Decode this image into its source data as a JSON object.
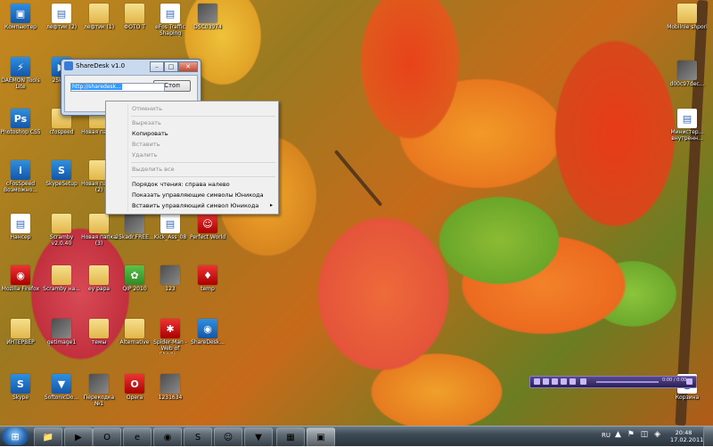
{
  "desktop_icons": [
    {
      "label": "Компьютер",
      "kind": "blue",
      "glyph": "▣"
    },
    {
      "label": "лефтик (2)",
      "kind": "doc",
      "glyph": "▤"
    },
    {
      "label": "лефтик (1)",
      "kind": "folder",
      "glyph": ""
    },
    {
      "label": "ФОТО Т",
      "kind": "folder",
      "glyph": ""
    },
    {
      "label": "eFos Traffic Shaping",
      "kind": "doc",
      "glyph": "▤"
    },
    {
      "label": "DSC03974",
      "kind": "photo",
      "glyph": ""
    },
    {
      "label": "DAEMON Tools Lite",
      "kind": "blue",
      "glyph": "⚡"
    },
    {
      "label": "25kadr",
      "kind": "blue",
      "glyph": "▶"
    },
    {
      "label": "Photoshop CS5",
      "kind": "blue",
      "glyph": "Ps"
    },
    {
      "label": "cfospeed",
      "kind": "folder",
      "glyph": ""
    },
    {
      "label": "Новая папка",
      "kind": "folder",
      "glyph": ""
    },
    {
      "label": "cFosSpeed Возможно...",
      "kind": "blue",
      "glyph": "i"
    },
    {
      "label": "SkypeSetup",
      "kind": "blue",
      "glyph": "S"
    },
    {
      "label": "Новая папка (2)",
      "kind": "folder",
      "glyph": ""
    },
    {
      "label": "Нансер",
      "kind": "doc",
      "glyph": "▤"
    },
    {
      "label": "Scramby v2.0.40",
      "kind": "folder",
      "glyph": ""
    },
    {
      "label": "Новая папка (3)",
      "kind": "folder",
      "glyph": ""
    },
    {
      "label": "25kadr.FREE...",
      "kind": "photo",
      "glyph": ""
    },
    {
      "label": "Kick_Ass_08",
      "kind": "doc",
      "glyph": "▤"
    },
    {
      "label": "Perfect World",
      "kind": "red",
      "glyph": "☺"
    },
    {
      "label": "Mozilla Firefox",
      "kind": "red",
      "glyph": "◉"
    },
    {
      "label": "Scramby на...",
      "kind": "folder",
      "glyph": ""
    },
    {
      "label": "ey papa",
      "kind": "folder",
      "glyph": ""
    },
    {
      "label": "QIP 2010",
      "kind": "green",
      "glyph": "✿"
    },
    {
      "label": "123",
      "kind": "photo",
      "glyph": ""
    },
    {
      "label": "temp",
      "kind": "red",
      "glyph": "♦"
    },
    {
      "label": "ИНТЕРВЕР",
      "kind": "folder",
      "glyph": ""
    },
    {
      "label": "getimage1",
      "kind": "photo",
      "glyph": ""
    },
    {
      "label": "темы",
      "kind": "folder",
      "glyph": ""
    },
    {
      "label": "Alternative",
      "kind": "folder",
      "glyph": ""
    },
    {
      "label": "Spider-Man - Web of Shado...",
      "kind": "red",
      "glyph": "✱"
    },
    {
      "label": "ShareDesk...",
      "kind": "blue",
      "glyph": "◉"
    },
    {
      "label": "Skype",
      "kind": "blue",
      "glyph": "S"
    },
    {
      "label": "SoftonicDo...",
      "kind": "blue",
      "glyph": "▼"
    },
    {
      "label": "Перекодка №1",
      "kind": "photo",
      "glyph": ""
    },
    {
      "label": "Opera",
      "kind": "red",
      "glyph": "O"
    },
    {
      "label": "1231634",
      "kind": "photo",
      "glyph": ""
    },
    {
      "label": "Mobilnie shpori",
      "kind": "folder",
      "glyph": ""
    },
    {
      "label": "d00c97dec...",
      "kind": "photo",
      "glyph": ""
    },
    {
      "label": "Министер... внутренн...",
      "kind": "doc",
      "glyph": "▤"
    },
    {
      "label": "Корзина",
      "kind": "doc",
      "glyph": "🗑"
    }
  ],
  "sharedesk": {
    "title": "ShareDesk v1.0",
    "min": "–",
    "max": "□",
    "close": "✕",
    "stop_label": "Стоп",
    "url_value": "http://sharedesk..."
  },
  "context_menu": {
    "undo": "Отменить",
    "cut": "Вырезать",
    "copy": "Копировать",
    "paste": "Вставить",
    "delete": "Удалить",
    "select_all": "Выделить все",
    "rtl": "Порядок чтения: справа налево",
    "show_unicode": "Показать управляющие символы Юникода",
    "insert_unicode": "Вставить управляющий символ Юникода",
    "submenu_arrow": "▸"
  },
  "player": {
    "time": "0:00 / 0:00"
  },
  "taskbar": {
    "start_glyph": "⊞",
    "buttons": [
      "📁",
      "▶",
      "O",
      "e",
      "◉",
      "S",
      "☺",
      "▼",
      "▦",
      "▣"
    ],
    "lang": "RU",
    "tray": "▲ ⚑ ◫ ◈",
    "time": "20:48",
    "date": "17.02.2011"
  }
}
